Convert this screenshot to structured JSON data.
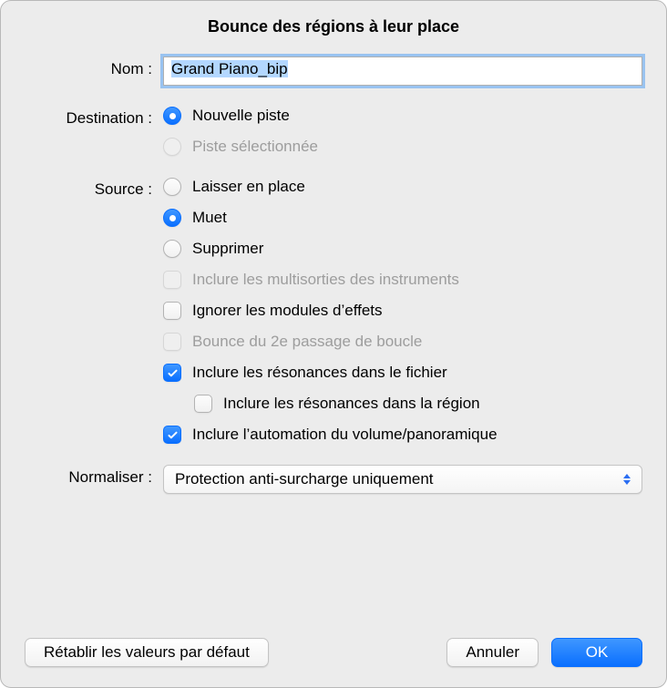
{
  "dialog": {
    "title": "Bounce des régions à leur place",
    "name_label": "Nom :",
    "name_value": "Grand Piano_bip",
    "destination_label": "Destination :",
    "destination_options": [
      {
        "label": "Nouvelle piste",
        "checked": true,
        "disabled": false
      },
      {
        "label": "Piste sélectionnée",
        "checked": false,
        "disabled": true
      }
    ],
    "source_label": "Source :",
    "source_radio": [
      {
        "label": "Laisser en place",
        "checked": false
      },
      {
        "label": "Muet",
        "checked": true
      },
      {
        "label": "Supprimer",
        "checked": false
      }
    ],
    "source_checks": [
      {
        "label": "Inclure les multisorties des instruments",
        "checked": false,
        "disabled": true,
        "indent": false
      },
      {
        "label": "Ignorer les modules d’effets",
        "checked": false,
        "disabled": false,
        "indent": false
      },
      {
        "label": "Bounce du 2e passage de boucle",
        "checked": false,
        "disabled": true,
        "indent": false
      },
      {
        "label": "Inclure les résonances dans le fichier",
        "checked": true,
        "disabled": false,
        "indent": false
      },
      {
        "label": "Inclure les résonances dans la région",
        "checked": false,
        "disabled": false,
        "indent": true
      },
      {
        "label": "Inclure l’automation du volume/panoramique",
        "checked": true,
        "disabled": false,
        "indent": false
      }
    ],
    "normalize_label": "Normaliser :",
    "normalize_value": "Protection anti-surcharge uniquement",
    "buttons": {
      "reset": "Rétablir les valeurs par défaut",
      "cancel": "Annuler",
      "ok": "OK"
    }
  }
}
